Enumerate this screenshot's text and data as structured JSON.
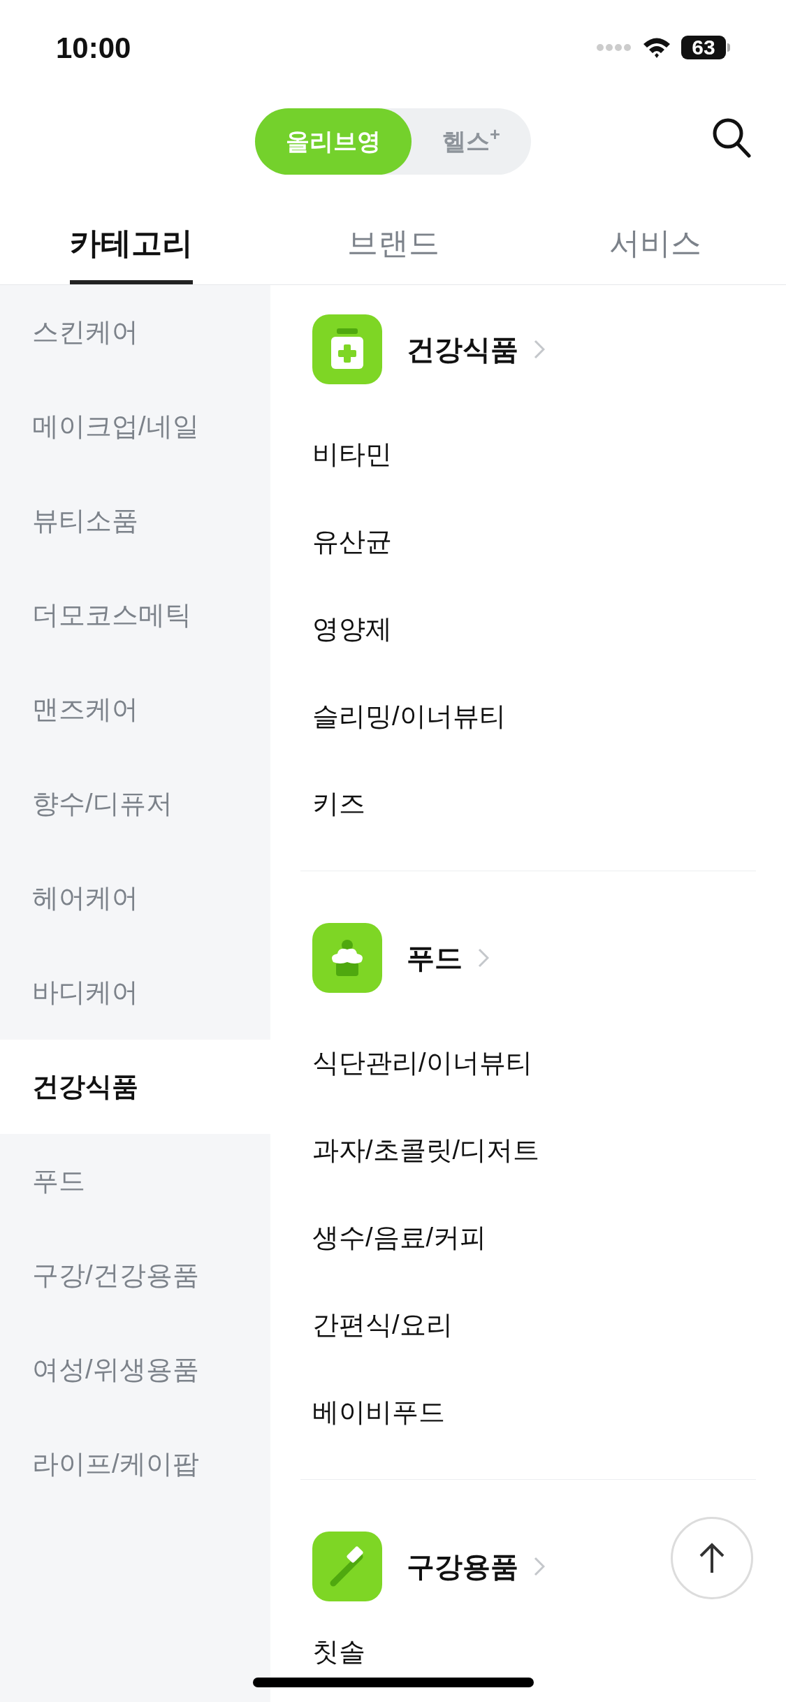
{
  "status_bar": {
    "time": "10:00",
    "battery": "63"
  },
  "mall_toggle": [
    {
      "label": "올리브영",
      "selected": true
    },
    {
      "label": "헬스$^{+}$",
      "selected": false
    }
  ],
  "tabs": [
    {
      "label": "카테고리",
      "selected": true
    },
    {
      "label": "브랜드",
      "selected": false
    },
    {
      "label": "서비스",
      "selected": false
    }
  ],
  "sidebar": {
    "items": [
      {
        "label": "스킨케어",
        "selected": false
      },
      {
        "label": "메이크업/네일",
        "selected": false
      },
      {
        "label": "뷰티소품",
        "selected": false
      },
      {
        "label": "더모코스메틱",
        "selected": false
      },
      {
        "label": "맨즈케어",
        "selected": false
      },
      {
        "label": "향수/디퓨저",
        "selected": false
      },
      {
        "label": "헤어케어",
        "selected": false
      },
      {
        "label": "바디케어",
        "selected": false
      },
      {
        "label": "건강식품",
        "selected": true
      },
      {
        "label": "푸드",
        "selected": false
      },
      {
        "label": "구강/건강용품",
        "selected": false
      },
      {
        "label": "여성/위생용품",
        "selected": false
      },
      {
        "label": "라이프/케이팝",
        "selected": false
      }
    ]
  },
  "sections": [
    {
      "kind": "supplement",
      "title": "건강식품",
      "items": [
        "비타민",
        "유산균",
        "영양제",
        "슬리밍/이너뷰티",
        "키즈"
      ]
    },
    {
      "kind": "food",
      "title": "푸드",
      "items": [
        "식단관리/이너뷰티",
        "과자/초콜릿/디저트",
        "생수/음료/커피",
        "간편식/요리",
        "베이비푸드"
      ]
    },
    {
      "kind": "oral",
      "title": "구강용품",
      "items": [
        "칫솔"
      ]
    }
  ]
}
